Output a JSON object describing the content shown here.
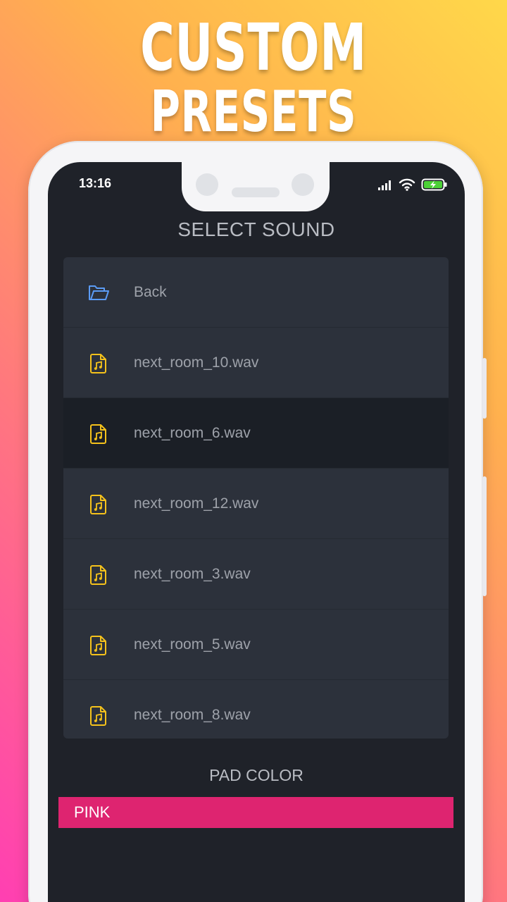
{
  "promo": {
    "line1": "CUSTOM",
    "line2": "PRESETS"
  },
  "status": {
    "time": "13:16"
  },
  "dialog": {
    "title": "SELECT SOUND",
    "items": [
      {
        "label": "Back",
        "icon": "folder-open-icon",
        "selected": false
      },
      {
        "label": "next_room_10.wav",
        "icon": "audio-file-icon",
        "selected": false
      },
      {
        "label": "next_room_6.wav",
        "icon": "audio-file-icon",
        "selected": true
      },
      {
        "label": "next_room_12.wav",
        "icon": "audio-file-icon",
        "selected": false
      },
      {
        "label": "next_room_3.wav",
        "icon": "audio-file-icon",
        "selected": false
      },
      {
        "label": "next_room_5.wav",
        "icon": "audio-file-icon",
        "selected": false
      },
      {
        "label": "next_room_8.wav",
        "icon": "audio-file-icon",
        "selected": false
      }
    ]
  },
  "pad_color": {
    "title": "PAD COLOR",
    "value": "PINK"
  },
  "colors": {
    "accent": "#de2470",
    "folder_icon": "#5b9bf5",
    "file_icon": "#f5c21b",
    "battery": "#4cd137"
  }
}
